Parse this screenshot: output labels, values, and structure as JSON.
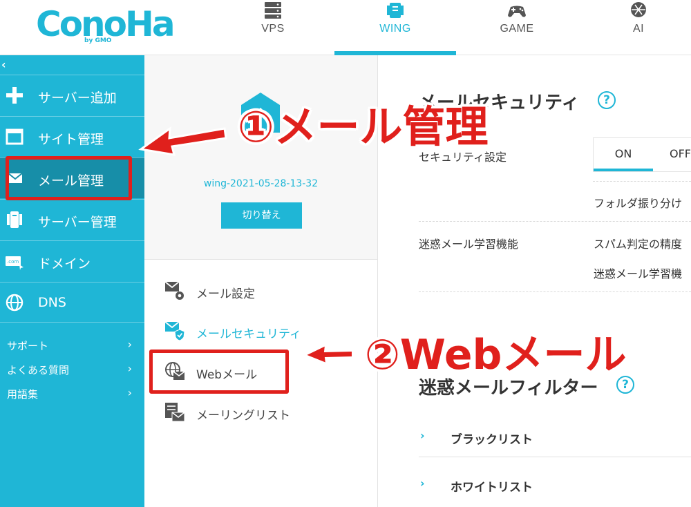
{
  "header": {
    "logo_text": "ConoHa",
    "logo_sub": "by GMO",
    "tabs": [
      {
        "label": "VPS",
        "icon": "server-stack-icon"
      },
      {
        "label": "WING",
        "icon": "wing-server-icon"
      },
      {
        "label": "GAME",
        "icon": "gamepad-icon"
      },
      {
        "label": "AI",
        "icon": "ai-chip-icon"
      }
    ],
    "active_tab": "WING"
  },
  "sidebar": {
    "collapse": "‹",
    "items": [
      {
        "label": "サーバー追加",
        "icon": "plus-icon"
      },
      {
        "label": "サイト管理",
        "icon": "window-icon"
      },
      {
        "label": "メール管理",
        "icon": "mail-icon"
      },
      {
        "label": "サーバー管理",
        "icon": "server-icon"
      },
      {
        "label": "ドメイン",
        "icon": "domain-com-icon"
      },
      {
        "label": "DNS",
        "icon": "globe-icon"
      }
    ],
    "active_item": "メール管理",
    "links": [
      {
        "label": "サポート",
        "chevron": "›"
      },
      {
        "label": "よくある質問",
        "chevron": "›"
      },
      {
        "label": "用語集",
        "chevron": "›"
      }
    ]
  },
  "middle": {
    "server_name": "wing-2021-05-28-13-32",
    "switch_label": "切り替え",
    "menu": [
      {
        "label": "メール設定",
        "icon": "mail-gear-icon"
      },
      {
        "label": "メールセキュリティ",
        "icon": "mail-shield-icon"
      },
      {
        "label": "Webメール",
        "icon": "web-mail-icon"
      },
      {
        "label": "メーリングリスト",
        "icon": "mailing-list-icon"
      }
    ],
    "active_menu": "メールセキュリティ"
  },
  "main": {
    "security_title": "メールセキュリティ",
    "help": "?",
    "security_setting_label": "セキュリティ設定",
    "toggle_on": "ON",
    "toggle_off": "OFF",
    "folder_sort_label": "フォルダ振り分け",
    "spam_learning_label": "迷惑メール学習機能",
    "spam_precision_label": "スパム判定の精度",
    "spam_learning_sub_label": "迷惑メール学習機",
    "filter_title": "迷惑メールフィルター",
    "blacklist_label": "ブラックリスト",
    "whitelist_label": "ホワイトリスト",
    "chevron": "›"
  },
  "annotations": {
    "step1": "①メール管理",
    "step2": "②Webメール",
    "color": "#e0201c"
  },
  "colors": {
    "brand": "#1fb6d6",
    "sidebar_active": "#178ea8",
    "annotation": "#e0201c"
  }
}
